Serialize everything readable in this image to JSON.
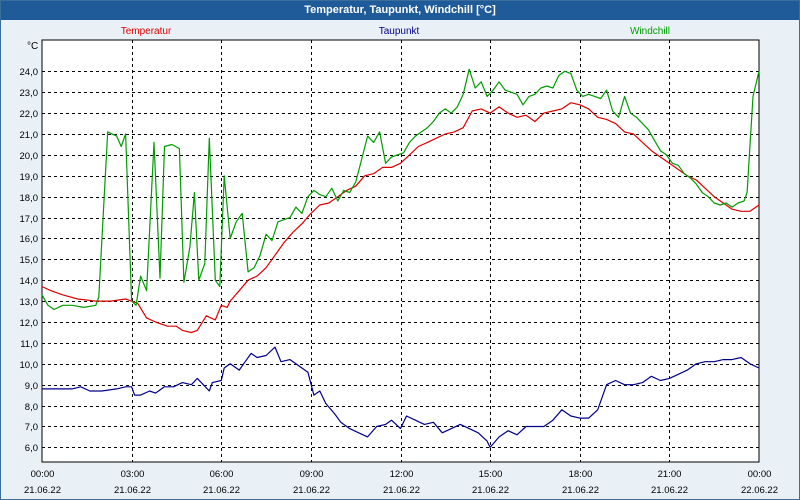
{
  "window": {
    "title": "Temperatur, Taupunkt, Windchill [°C]"
  },
  "chart_data": {
    "type": "line",
    "title": "Temperatur, Taupunkt, Windchill [°C]",
    "ylabel": "°C",
    "xlabel": "",
    "ylim": [
      5.3,
      25.5
    ],
    "yticks": [
      6.0,
      7.0,
      8.0,
      9.0,
      10.0,
      11.0,
      12.0,
      13.0,
      14.0,
      15.0,
      16.0,
      17.0,
      18.0,
      19.0,
      20.0,
      21.0,
      22.0,
      23.0,
      24.0
    ],
    "ytick_labels": [
      "6,0",
      "7,0",
      "8,0",
      "9,0",
      "10,0",
      "11,0",
      "12,0",
      "13,0",
      "14,0",
      "15,0",
      "16,0",
      "17,0",
      "18,0",
      "19,0",
      "20,0",
      "21,0",
      "22,0",
      "23,0",
      "24,0"
    ],
    "xlim": [
      0,
      24
    ],
    "xticks": [
      {
        "hour": 0,
        "time": "00:00",
        "date": "21.06.22"
      },
      {
        "hour": 3,
        "time": "03:00",
        "date": "21.06.22"
      },
      {
        "hour": 6,
        "time": "06:00",
        "date": "21.06.22"
      },
      {
        "hour": 9,
        "time": "09:00",
        "date": "21.06.22"
      },
      {
        "hour": 12,
        "time": "12:00",
        "date": "21.06.22"
      },
      {
        "hour": 15,
        "time": "15:00",
        "date": "21.06.22"
      },
      {
        "hour": 18,
        "time": "18:00",
        "date": "21.06.22"
      },
      {
        "hour": 21,
        "time": "21:00",
        "date": "21.06.22"
      },
      {
        "hour": 24,
        "time": "00:00",
        "date": "22.06.22"
      }
    ],
    "grid": true,
    "legend_position": "top",
    "series": [
      {
        "name": "Temperatur",
        "color": "#dd0000",
        "points": [
          [
            0,
            13.7
          ],
          [
            0.3,
            13.5
          ],
          [
            0.7,
            13.3
          ],
          [
            1.2,
            13.1
          ],
          [
            1.8,
            13.0
          ],
          [
            2.3,
            13.0
          ],
          [
            2.8,
            13.1
          ],
          [
            3.2,
            12.9
          ],
          [
            3.5,
            12.2
          ],
          [
            3.8,
            12.0
          ],
          [
            4.2,
            11.8
          ],
          [
            4.5,
            11.8
          ],
          [
            4.7,
            11.6
          ],
          [
            5.0,
            11.5
          ],
          [
            5.2,
            11.6
          ],
          [
            5.5,
            12.3
          ],
          [
            5.8,
            12.1
          ],
          [
            6.0,
            12.8
          ],
          [
            6.2,
            12.7
          ],
          [
            6.3,
            13.0
          ],
          [
            6.6,
            13.5
          ],
          [
            6.9,
            14.0
          ],
          [
            7.2,
            14.2
          ],
          [
            7.5,
            14.6
          ],
          [
            7.8,
            15.2
          ],
          [
            8.1,
            15.8
          ],
          [
            8.4,
            16.3
          ],
          [
            8.7,
            16.7
          ],
          [
            9.0,
            17.2
          ],
          [
            9.3,
            17.6
          ],
          [
            9.6,
            17.7
          ],
          [
            9.9,
            18.0
          ],
          [
            10.2,
            18.3
          ],
          [
            10.5,
            18.5
          ],
          [
            10.8,
            19.0
          ],
          [
            11.1,
            19.1
          ],
          [
            11.4,
            19.4
          ],
          [
            11.7,
            19.4
          ],
          [
            12.0,
            19.6
          ],
          [
            12.3,
            20.0
          ],
          [
            12.6,
            20.4
          ],
          [
            12.9,
            20.6
          ],
          [
            13.2,
            20.8
          ],
          [
            13.5,
            21.0
          ],
          [
            13.8,
            21.1
          ],
          [
            14.1,
            21.3
          ],
          [
            14.4,
            22.1
          ],
          [
            14.7,
            22.2
          ],
          [
            15.0,
            22.0
          ],
          [
            15.3,
            22.3
          ],
          [
            15.6,
            22.0
          ],
          [
            15.9,
            21.8
          ],
          [
            16.2,
            21.9
          ],
          [
            16.5,
            21.6
          ],
          [
            16.8,
            22.0
          ],
          [
            17.1,
            22.1
          ],
          [
            17.4,
            22.2
          ],
          [
            17.7,
            22.5
          ],
          [
            18.0,
            22.4
          ],
          [
            18.3,
            22.2
          ],
          [
            18.6,
            21.8
          ],
          [
            18.9,
            21.7
          ],
          [
            19.2,
            21.5
          ],
          [
            19.5,
            21.1
          ],
          [
            19.8,
            21.0
          ],
          [
            20.1,
            20.6
          ],
          [
            20.4,
            20.2
          ],
          [
            20.7,
            19.9
          ],
          [
            21.0,
            19.6
          ],
          [
            21.3,
            19.3
          ],
          [
            21.6,
            19.0
          ],
          [
            21.9,
            18.8
          ],
          [
            22.2,
            18.4
          ],
          [
            22.5,
            18.0
          ],
          [
            22.8,
            17.7
          ],
          [
            23.1,
            17.4
          ],
          [
            23.4,
            17.3
          ],
          [
            23.7,
            17.3
          ],
          [
            24.0,
            17.6
          ]
        ]
      },
      {
        "name": "Taupunkt",
        "color": "#00008b",
        "points": [
          [
            0,
            8.8
          ],
          [
            0.5,
            8.8
          ],
          [
            1.0,
            8.8
          ],
          [
            1.3,
            8.9
          ],
          [
            1.6,
            8.7
          ],
          [
            2.0,
            8.7
          ],
          [
            2.5,
            8.8
          ],
          [
            2.8,
            8.9
          ],
          [
            3.0,
            8.9
          ],
          [
            3.1,
            8.5
          ],
          [
            3.3,
            8.5
          ],
          [
            3.6,
            8.7
          ],
          [
            3.8,
            8.6
          ],
          [
            4.1,
            8.9
          ],
          [
            4.4,
            8.9
          ],
          [
            4.7,
            9.1
          ],
          [
            5.0,
            9.0
          ],
          [
            5.2,
            9.3
          ],
          [
            5.4,
            9.0
          ],
          [
            5.6,
            8.7
          ],
          [
            5.7,
            9.1
          ],
          [
            6.0,
            9.2
          ],
          [
            6.1,
            9.8
          ],
          [
            6.3,
            10.0
          ],
          [
            6.6,
            9.7
          ],
          [
            6.8,
            10.1
          ],
          [
            7.0,
            10.5
          ],
          [
            7.2,
            10.3
          ],
          [
            7.5,
            10.4
          ],
          [
            7.8,
            10.8
          ],
          [
            8.0,
            10.1
          ],
          [
            8.3,
            10.2
          ],
          [
            8.6,
            9.9
          ],
          [
            8.9,
            9.6
          ],
          [
            9.1,
            8.5
          ],
          [
            9.3,
            8.7
          ],
          [
            9.5,
            8.1
          ],
          [
            9.8,
            7.6
          ],
          [
            10.0,
            7.2
          ],
          [
            10.3,
            6.9
          ],
          [
            10.6,
            6.7
          ],
          [
            10.9,
            6.5
          ],
          [
            11.2,
            7.0
          ],
          [
            11.5,
            7.1
          ],
          [
            11.7,
            7.3
          ],
          [
            12.0,
            6.9
          ],
          [
            12.2,
            7.5
          ],
          [
            12.5,
            7.3
          ],
          [
            12.8,
            7.1
          ],
          [
            13.1,
            7.2
          ],
          [
            13.4,
            6.7
          ],
          [
            13.7,
            6.9
          ],
          [
            14.0,
            7.1
          ],
          [
            14.3,
            6.9
          ],
          [
            14.6,
            6.7
          ],
          [
            14.9,
            6.3
          ],
          [
            15.0,
            6.0
          ],
          [
            15.3,
            6.5
          ],
          [
            15.6,
            6.8
          ],
          [
            15.9,
            6.6
          ],
          [
            16.2,
            7.0
          ],
          [
            16.5,
            7.0
          ],
          [
            16.8,
            7.0
          ],
          [
            17.1,
            7.3
          ],
          [
            17.4,
            7.8
          ],
          [
            17.7,
            7.5
          ],
          [
            18.0,
            7.4
          ],
          [
            18.3,
            7.4
          ],
          [
            18.6,
            7.8
          ],
          [
            18.9,
            9.0
          ],
          [
            19.2,
            9.2
          ],
          [
            19.5,
            9.0
          ],
          [
            19.8,
            9.0
          ],
          [
            20.1,
            9.1
          ],
          [
            20.4,
            9.4
          ],
          [
            20.7,
            9.2
          ],
          [
            21.0,
            9.3
          ],
          [
            21.3,
            9.5
          ],
          [
            21.6,
            9.7
          ],
          [
            21.9,
            10.0
          ],
          [
            22.2,
            10.1
          ],
          [
            22.5,
            10.1
          ],
          [
            22.8,
            10.2
          ],
          [
            23.1,
            10.2
          ],
          [
            23.4,
            10.3
          ],
          [
            23.7,
            10.0
          ],
          [
            24.0,
            9.8
          ]
        ]
      },
      {
        "name": "Windchill",
        "color": "#009c00",
        "points": [
          [
            0,
            13.3
          ],
          [
            0.2,
            12.8
          ],
          [
            0.4,
            12.6
          ],
          [
            0.7,
            12.8
          ],
          [
            1.0,
            12.8
          ],
          [
            1.4,
            12.7
          ],
          [
            1.8,
            12.8
          ],
          [
            1.9,
            13.2
          ],
          [
            2.2,
            21.1
          ],
          [
            2.5,
            20.9
          ],
          [
            2.65,
            20.4
          ],
          [
            2.8,
            21.0
          ],
          [
            3.0,
            13.0
          ],
          [
            3.15,
            12.8
          ],
          [
            3.3,
            14.2
          ],
          [
            3.5,
            13.5
          ],
          [
            3.75,
            20.6
          ],
          [
            3.95,
            14.1
          ],
          [
            4.1,
            20.4
          ],
          [
            4.35,
            20.5
          ],
          [
            4.6,
            20.3
          ],
          [
            4.75,
            13.9
          ],
          [
            4.95,
            15.6
          ],
          [
            5.1,
            18.2
          ],
          [
            5.25,
            14.0
          ],
          [
            5.45,
            14.8
          ],
          [
            5.6,
            20.8
          ],
          [
            5.8,
            14.0
          ],
          [
            5.95,
            13.7
          ],
          [
            6.1,
            19.0
          ],
          [
            6.3,
            16.0
          ],
          [
            6.5,
            16.8
          ],
          [
            6.7,
            17.2
          ],
          [
            6.9,
            14.4
          ],
          [
            7.1,
            14.6
          ],
          [
            7.3,
            15.2
          ],
          [
            7.5,
            16.2
          ],
          [
            7.7,
            15.9
          ],
          [
            7.9,
            16.8
          ],
          [
            8.1,
            16.9
          ],
          [
            8.3,
            17.0
          ],
          [
            8.5,
            17.5
          ],
          [
            8.7,
            17.2
          ],
          [
            8.9,
            18.0
          ],
          [
            9.1,
            18.3
          ],
          [
            9.3,
            18.1
          ],
          [
            9.5,
            18.0
          ],
          [
            9.7,
            18.4
          ],
          [
            9.9,
            17.8
          ],
          [
            10.1,
            18.3
          ],
          [
            10.3,
            18.2
          ],
          [
            10.5,
            18.7
          ],
          [
            10.7,
            19.8
          ],
          [
            10.9,
            20.9
          ],
          [
            11.1,
            20.6
          ],
          [
            11.3,
            21.1
          ],
          [
            11.5,
            19.6
          ],
          [
            11.7,
            19.9
          ],
          [
            11.9,
            20.0
          ],
          [
            12.1,
            20.1
          ],
          [
            12.3,
            20.6
          ],
          [
            12.5,
            20.9
          ],
          [
            12.7,
            21.1
          ],
          [
            12.9,
            21.3
          ],
          [
            13.1,
            21.6
          ],
          [
            13.3,
            22.0
          ],
          [
            13.5,
            22.2
          ],
          [
            13.7,
            22.0
          ],
          [
            13.9,
            22.3
          ],
          [
            14.1,
            22.9
          ],
          [
            14.3,
            24.1
          ],
          [
            14.5,
            23.2
          ],
          [
            14.7,
            23.5
          ],
          [
            14.9,
            22.8
          ],
          [
            15.1,
            23.1
          ],
          [
            15.3,
            23.5
          ],
          [
            15.5,
            23.1
          ],
          [
            15.7,
            23.0
          ],
          [
            15.9,
            22.9
          ],
          [
            16.1,
            22.4
          ],
          [
            16.3,
            22.8
          ],
          [
            16.5,
            22.9
          ],
          [
            16.7,
            23.2
          ],
          [
            16.9,
            23.3
          ],
          [
            17.1,
            23.2
          ],
          [
            17.3,
            23.8
          ],
          [
            17.5,
            24.0
          ],
          [
            17.7,
            23.9
          ],
          [
            17.9,
            23.1
          ],
          [
            18.1,
            22.8
          ],
          [
            18.3,
            22.9
          ],
          [
            18.5,
            22.8
          ],
          [
            18.7,
            22.7
          ],
          [
            18.9,
            23.1
          ],
          [
            19.1,
            22.1
          ],
          [
            19.3,
            21.8
          ],
          [
            19.5,
            22.8
          ],
          [
            19.7,
            22.0
          ],
          [
            19.9,
            21.8
          ],
          [
            20.1,
            21.5
          ],
          [
            20.3,
            21.2
          ],
          [
            20.5,
            20.7
          ],
          [
            20.7,
            20.2
          ],
          [
            20.9,
            20.0
          ],
          [
            21.1,
            19.6
          ],
          [
            21.3,
            19.5
          ],
          [
            21.5,
            19.1
          ],
          [
            21.7,
            18.9
          ],
          [
            21.9,
            18.6
          ],
          [
            22.1,
            18.2
          ],
          [
            22.3,
            18.0
          ],
          [
            22.5,
            17.7
          ],
          [
            22.7,
            17.6
          ],
          [
            22.9,
            17.7
          ],
          [
            23.1,
            17.5
          ],
          [
            23.3,
            17.7
          ],
          [
            23.5,
            17.8
          ],
          [
            23.6,
            18.2
          ],
          [
            23.8,
            22.8
          ],
          [
            24.0,
            24.0
          ]
        ]
      }
    ]
  }
}
